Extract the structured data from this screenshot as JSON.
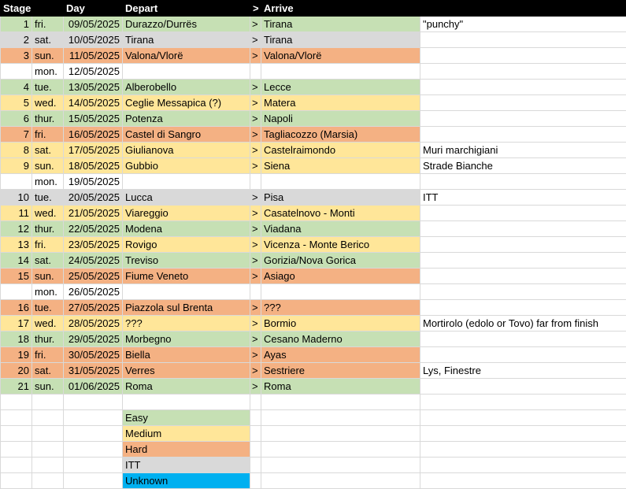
{
  "headers": {
    "stage": "Stage",
    "day": "Day",
    "depart": "Depart",
    "arrow": ">",
    "arrive": "Arrive"
  },
  "colors": {
    "easy": "#c6e0b4",
    "medium": "#ffe699",
    "hard": "#f4b183",
    "itt": "#d9d9d9",
    "unknown": "#00b0f0"
  },
  "rows": [
    {
      "stage": "1",
      "dow": "fri.",
      "date": "09/05/2025",
      "depart": "Durazzo/Durrës",
      "arrow": ">",
      "arrive": "Tirana",
      "notes": "\"punchy\"",
      "difficulty": "easy"
    },
    {
      "stage": "2",
      "dow": "sat.",
      "date": "10/05/2025",
      "depart": "Tirana",
      "arrow": ">",
      "arrive": "Tirana",
      "notes": "",
      "difficulty": "itt"
    },
    {
      "stage": "3",
      "dow": "sun.",
      "date": "11/05/2025",
      "depart": "Valona/Vlorë",
      "arrow": ">",
      "arrive": "Valona/Vlorë",
      "notes": "",
      "difficulty": "hard"
    },
    {
      "stage": "",
      "dow": "mon.",
      "date": "12/05/2025",
      "depart": "",
      "arrow": "",
      "arrive": "",
      "notes": "",
      "difficulty": "rest"
    },
    {
      "stage": "4",
      "dow": "tue.",
      "date": "13/05/2025",
      "depart": "Alberobello",
      "arrow": ">",
      "arrive": "Lecce",
      "notes": "",
      "difficulty": "easy"
    },
    {
      "stage": "5",
      "dow": "wed.",
      "date": "14/05/2025",
      "depart": "Ceglie Messapica (?)",
      "arrow": ">",
      "arrive": "Matera",
      "notes": "",
      "difficulty": "medium"
    },
    {
      "stage": "6",
      "dow": "thur.",
      "date": "15/05/2025",
      "depart": "Potenza",
      "arrow": ">",
      "arrive": "Napoli",
      "notes": "",
      "difficulty": "easy"
    },
    {
      "stage": "7",
      "dow": "fri.",
      "date": "16/05/2025",
      "depart": "Castel di Sangro",
      "arrow": ">",
      "arrive": "Tagliacozzo (Marsia)",
      "notes": "",
      "difficulty": "hard"
    },
    {
      "stage": "8",
      "dow": "sat.",
      "date": "17/05/2025",
      "depart": "Giulianova",
      "arrow": ">",
      "arrive": "Castelraimondo",
      "notes": "Muri marchigiani",
      "difficulty": "medium"
    },
    {
      "stage": "9",
      "dow": "sun.",
      "date": "18/05/2025",
      "depart": "Gubbio",
      "arrow": ">",
      "arrive": "Siena",
      "notes": "Strade Bianche",
      "difficulty": "medium"
    },
    {
      "stage": "",
      "dow": "mon.",
      "date": "19/05/2025",
      "depart": "",
      "arrow": "",
      "arrive": "",
      "notes": "",
      "difficulty": "rest"
    },
    {
      "stage": "10",
      "dow": "tue.",
      "date": "20/05/2025",
      "depart": "Lucca",
      "arrow": ">",
      "arrive": "Pisa",
      "notes": "ITT",
      "difficulty": "itt"
    },
    {
      "stage": "11",
      "dow": "wed.",
      "date": "21/05/2025",
      "depart": "Viareggio",
      "arrow": ">",
      "arrive": "Casatelnovo - Monti",
      "notes": "",
      "difficulty": "medium"
    },
    {
      "stage": "12",
      "dow": "thur.",
      "date": "22/05/2025",
      "depart": "Modena",
      "arrow": ">",
      "arrive": "Viadana",
      "notes": "",
      "difficulty": "easy"
    },
    {
      "stage": "13",
      "dow": "fri.",
      "date": "23/05/2025",
      "depart": "Rovigo",
      "arrow": ">",
      "arrive": "Vicenza - Monte Berico",
      "notes": "",
      "difficulty": "medium"
    },
    {
      "stage": "14",
      "dow": "sat.",
      "date": "24/05/2025",
      "depart": "Treviso",
      "arrow": ">",
      "arrive": "Gorizia/Nova Gorica",
      "notes": "",
      "difficulty": "easy"
    },
    {
      "stage": "15",
      "dow": "sun.",
      "date": "25/05/2025",
      "depart": "Fiume Veneto",
      "arrow": ">",
      "arrive": "Asiago",
      "notes": "",
      "difficulty": "hard"
    },
    {
      "stage": "",
      "dow": "mon.",
      "date": "26/05/2025",
      "depart": "",
      "arrow": "",
      "arrive": "",
      "notes": "",
      "difficulty": "rest"
    },
    {
      "stage": "16",
      "dow": "tue.",
      "date": "27/05/2025",
      "depart": "Piazzola sul Brenta",
      "arrow": ">",
      "arrive": "???",
      "notes": "",
      "difficulty": "hard"
    },
    {
      "stage": "17",
      "dow": "wed.",
      "date": "28/05/2025",
      "depart": "???",
      "arrow": ">",
      "arrive": "Bormio",
      "notes": "Mortirolo (edolo or Tovo) far from finish",
      "difficulty": "medium"
    },
    {
      "stage": "18",
      "dow": "thur.",
      "date": "29/05/2025",
      "depart": "Morbegno",
      "arrow": ">",
      "arrive": "Cesano Maderno",
      "notes": "",
      "difficulty": "easy"
    },
    {
      "stage": "19",
      "dow": "fri.",
      "date": "30/05/2025",
      "depart": "Biella",
      "arrow": ">",
      "arrive": "Ayas",
      "notes": "",
      "difficulty": "hard"
    },
    {
      "stage": "20",
      "dow": "sat.",
      "date": "31/05/2025",
      "depart": "Verres",
      "arrow": ">",
      "arrive": "Sestriere",
      "notes": "Lys, Finestre",
      "difficulty": "hard"
    },
    {
      "stage": "21",
      "dow": "sun.",
      "date": "01/06/2025",
      "depart": "Roma",
      "arrow": ">",
      "arrive": "Roma",
      "notes": "",
      "difficulty": "easy"
    }
  ],
  "legend": [
    {
      "label": "Easy",
      "key": "easy"
    },
    {
      "label": "Medium",
      "key": "medium"
    },
    {
      "label": "Hard",
      "key": "hard"
    },
    {
      "label": "ITT",
      "key": "itt"
    },
    {
      "label": "Unknown",
      "key": "unknown"
    }
  ]
}
